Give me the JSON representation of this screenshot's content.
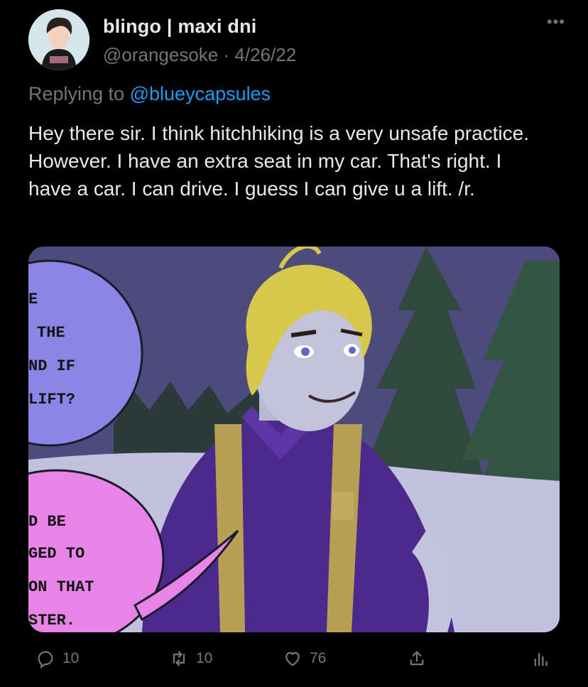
{
  "tweet": {
    "display_name": "blingo | maxi dni",
    "handle": "@orangesoke",
    "separator": "·",
    "date": "4/26/22",
    "replying_prefix": "Replying to",
    "replying_to": "@blueycapsules",
    "text": "Hey there sir. I think hitchhiking is a very unsafe practice. However. I have an extra seat in my car. That's right. I have a car. I can drive. I guess I can give u a lift. /r."
  },
  "media": {
    "bubble_top": [
      "E",
      "THE",
      "ND IF",
      "LIFT?"
    ],
    "bubble_bottom": [
      "D BE",
      "GED TO",
      "ON THAT",
      "STER."
    ]
  },
  "actions": {
    "reply_count": "10",
    "retweet_count": "10",
    "like_count": "76"
  },
  "icons": {
    "more": "more-icon",
    "reply": "reply-icon",
    "retweet": "retweet-icon",
    "like": "heart-icon",
    "share": "share-icon",
    "analytics": "analytics-icon"
  },
  "colors": {
    "background": "#000000",
    "text": "#e7e9ea",
    "muted": "#71767b",
    "link": "#1d9bf0"
  }
}
